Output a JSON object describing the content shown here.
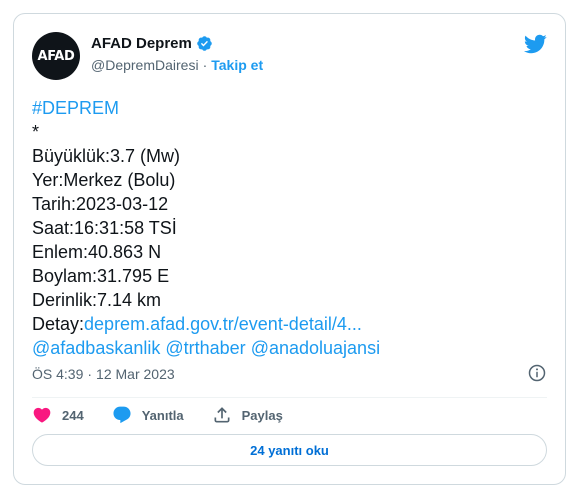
{
  "author": {
    "avatar_text": "AFAD",
    "display_name": "AFAD Deprem",
    "handle": "@DepremDairesi",
    "separator": "·",
    "follow_label": "Takip et"
  },
  "tweet": {
    "hashtag": "#DEPREM",
    "asterisk": "*",
    "magnitude": "Büyüklük:3.7 (Mw)",
    "location": "Yer:Merkez (Bolu)",
    "date": "Tarih:2023-03-12",
    "time": "Saat:16:31:58 TSİ",
    "latitude": "Enlem:40.863 N",
    "longitude": "Boylam:31.795 E",
    "depth": "Derinlik:7.14 km",
    "detail_prefix": "Detay:",
    "detail_link": "deprem.afad.gov.tr/event-detail/4...",
    "mention_1": "@afadbaskanlik",
    "mention_2": "@trthaber",
    "mention_3": "@anadoluajansi"
  },
  "meta": {
    "time": "ÖS 4:39",
    "separator": "·",
    "date": "12 Mar 2023"
  },
  "actions": {
    "like_count": "244",
    "reply_label": "Yanıtla",
    "share_label": "Paylaş"
  },
  "replies_button_label": "24 yanıtı oku",
  "colors": {
    "accent": "#1d9bf0",
    "like": "#f91880",
    "verified": "#1d9bf0",
    "text": "#0f1419",
    "muted": "#536471"
  },
  "icons": [
    "verified-badge-icon",
    "twitter-bird-icon",
    "info-icon",
    "heart-icon",
    "reply-bubble-icon",
    "share-icon"
  ]
}
